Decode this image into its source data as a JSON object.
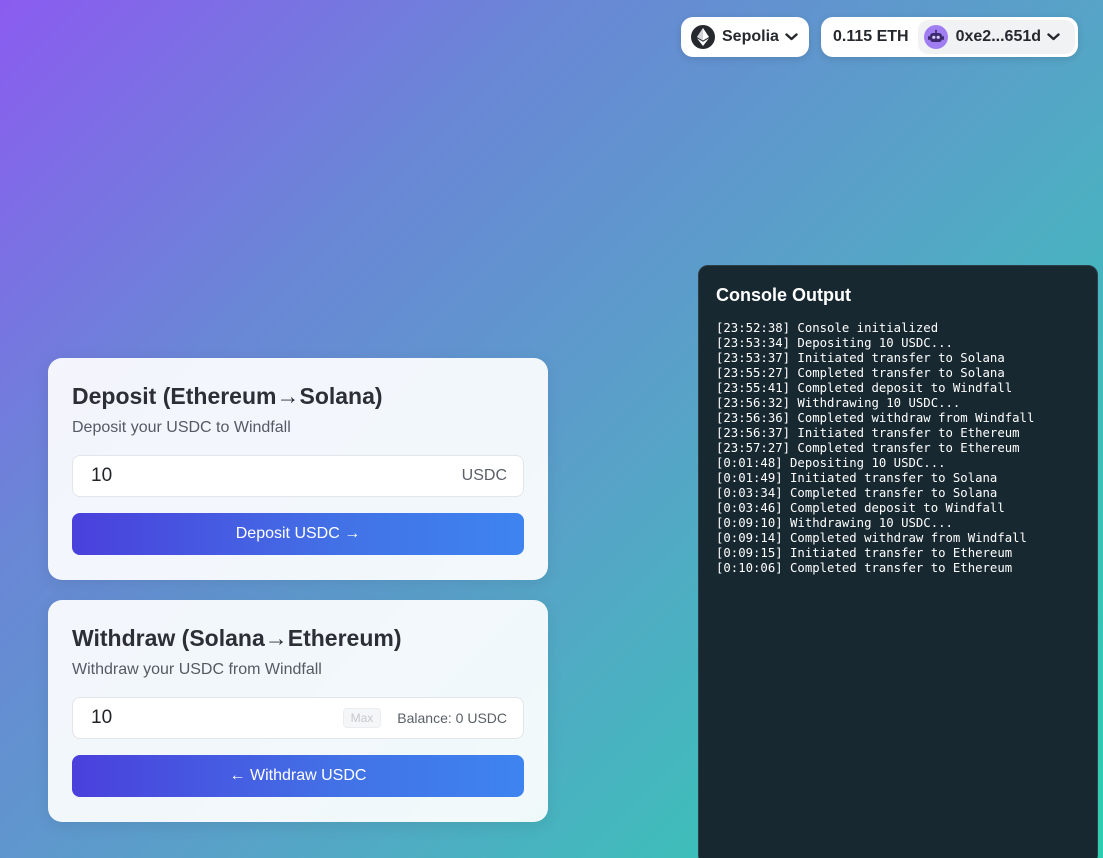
{
  "header": {
    "network": {
      "label": "Sepolia",
      "icon": "ethereum-icon"
    },
    "account": {
      "balance": "0.115 ETH",
      "address": "0xe2...651d",
      "avatar_icon": "robot-avatar-icon"
    }
  },
  "deposit": {
    "title": "Deposit (Ethereum→Solana)",
    "subtitle": "Deposit your USDC to Windfall",
    "amount_value": "10",
    "unit": "USDC",
    "button_label": "Deposit USDC →"
  },
  "withdraw": {
    "title": "Withdraw (Solana→Ethereum)",
    "subtitle": "Withdraw your USDC from Windfall",
    "amount_value": "10",
    "max_label": "Max",
    "balance_label": "Balance: 0 USDC",
    "button_label": "← Withdraw USDC"
  },
  "console": {
    "title": "Console Output",
    "lines": [
      "[23:52:38] Console initialized",
      "[23:53:34] Depositing 10 USDC...",
      "[23:53:37] Initiated transfer to Solana",
      "[23:55:27] Completed transfer to Solana",
      "[23:55:41] Completed deposit to Windfall",
      "[23:56:32] Withdrawing 10 USDC...",
      "[23:56:36] Completed withdraw from Windfall",
      "[23:56:37] Initiated transfer to Ethereum",
      "[23:57:27] Completed transfer to Ethereum",
      "[0:01:48] Depositing 10 USDC...",
      "[0:01:49] Initiated transfer to Solana",
      "[0:03:34] Completed transfer to Solana",
      "[0:03:46] Completed deposit to Windfall",
      "[0:09:10] Withdrawing 10 USDC...",
      "[0:09:14] Completed withdraw from Windfall",
      "[0:09:15] Initiated transfer to Ethereum",
      "[0:10:06] Completed transfer to Ethereum"
    ]
  },
  "colors": {
    "background_start": "#8b5cf0",
    "background_end": "#2ecdb0",
    "button_start": "#4a40dc",
    "button_end": "#3e84f0",
    "console_bg": "#172830"
  }
}
